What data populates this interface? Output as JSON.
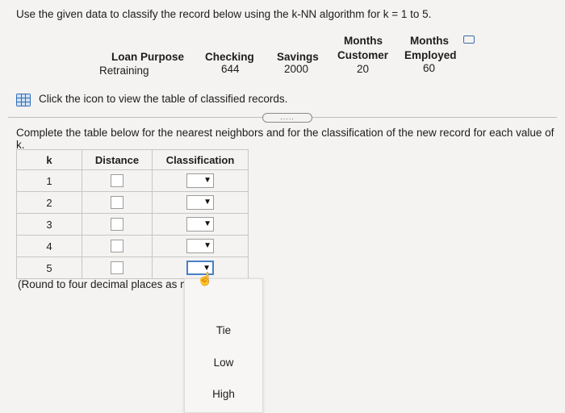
{
  "instruction": "Use the given data to classify the record below using the k-NN algorithm for k = 1 to 5.",
  "record": {
    "headers": [
      [
        "",
        "Loan Purpose"
      ],
      [
        "",
        "Checking"
      ],
      [
        "",
        "Savings"
      ],
      [
        "Months",
        "Customer"
      ],
      [
        "Months",
        "Employed"
      ]
    ],
    "values": [
      "Retraining",
      "644",
      "2000",
      "20",
      "60"
    ]
  },
  "click_text": "Click the icon to view the table of classified records.",
  "expander_label": ".....",
  "complete_text": "Complete the table below for the nearest neighbors and for the classification of the new record for each value of k.",
  "table": {
    "headers": [
      "k",
      "Distance",
      "Classification"
    ],
    "rows": [
      {
        "k": "1",
        "distance": "",
        "classification": ""
      },
      {
        "k": "2",
        "distance": "",
        "classification": ""
      },
      {
        "k": "3",
        "distance": "",
        "classification": ""
      },
      {
        "k": "4",
        "distance": "",
        "classification": ""
      },
      {
        "k": "5",
        "distance": "",
        "classification": ""
      }
    ]
  },
  "round_text": "(Round to four decimal places as ne",
  "dropdown_options": [
    "Tie",
    "Low",
    "High"
  ],
  "icons": {
    "arrow": "▼",
    "cursor": "☝"
  }
}
